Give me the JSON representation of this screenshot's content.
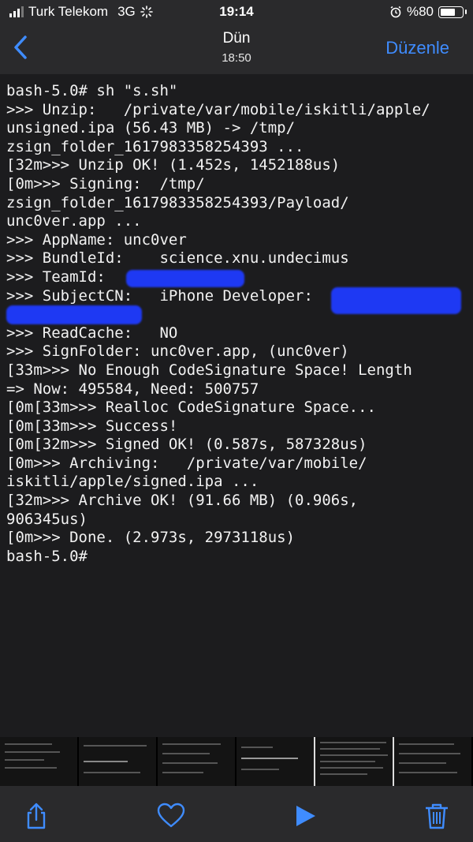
{
  "status_bar": {
    "carrier": "Turk Telekom",
    "network": "3G",
    "time": "19:14",
    "battery": "%80",
    "battery_level": 0.8
  },
  "nav": {
    "title": "Dün",
    "subtitle": "18:50",
    "edit_label": "Düzenle"
  },
  "terminal": {
    "text": "bash-5.0# sh \"s.sh\"\n>>> Unzip:   /private/var/mobile/iskitli/apple/\nunsigned.ipa (56.43 MB) -> /tmp/\nzsign_folder_1617983358254393 ...\n[32m>>> Unzip OK! (1.452s, 1452188us)\n[0m>>> Signing:  /tmp/\nzsign_folder_1617983358254393/Payload/\nunc0ver.app ...\n>>> AppName: unc0ver\n>>> BundleId:    science.xnu.undecimus\n>>> TeamId:   \n>>> SubjectCN:   iPhone Developer:\n\n>>> ReadCache:   NO\n>>> SignFolder: unc0ver.app, (unc0ver)\n[33m>>> No Enough CodeSignature Space! Length\n=> Now: 495584, Need: 500757\n[0m[33m>>> Realloc CodeSignature Space...\n[0m[33m>>> Success!\n[0m[32m>>> Signed OK! (0.587s, 587328us)\n[0m>>> Archiving:   /private/var/mobile/\niskitli/apple/signed.ipa ...\n[32m>>> Archive OK! (91.66 MB) (0.906s,\n906345us)\n[0m>>> Done. (2.973s, 2973118us)\nbash-5.0#"
  },
  "toolbar": {
    "share_icon": "share-icon",
    "favorite_icon": "heart-icon",
    "play_icon": "play-icon",
    "delete_icon": "trash-icon"
  },
  "colors": {
    "accent": "#3f8cff",
    "redaction": "#1f3bff",
    "background": "#1c1c1e"
  }
}
